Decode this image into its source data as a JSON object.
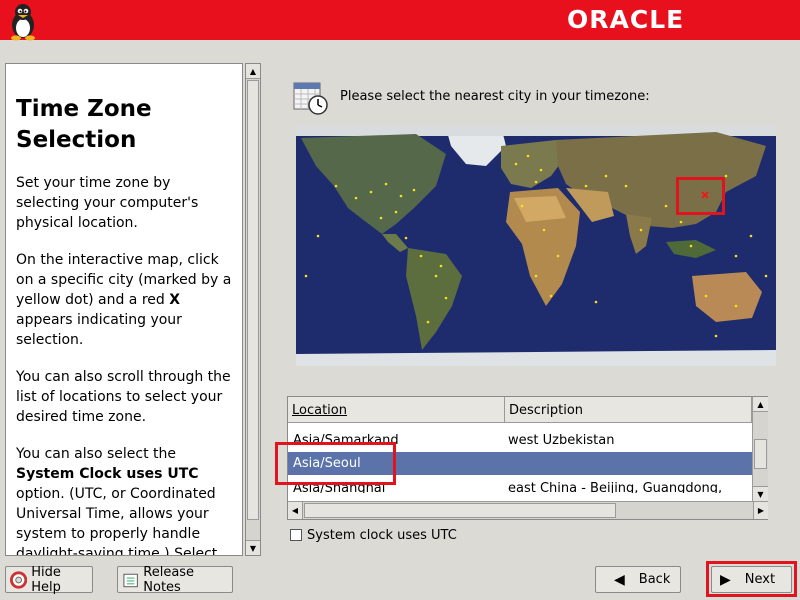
{
  "header": {
    "brand": "ORACLE"
  },
  "help": {
    "title": "Time Zone Selection",
    "p1": "Set your time zone by selecting your computer's physical location.",
    "p2a": "On the interactive map, click on a specific city (marked by a yellow dot) and a red ",
    "p2b": "X",
    "p2c": " appears indicating your selection.",
    "p3": "You can also scroll through the list of locations to select your desired time zone.",
    "p4a": "You can also select the ",
    "p4b": "System Clock uses UTC",
    "p4c": " option. (UTC, or Coordinated Universal Time, allows your system to properly handle daylight-saving time.) Select"
  },
  "main": {
    "instruction": "Please select the nearest city in your timezone:",
    "columns": [
      "Location",
      "Description"
    ],
    "rows": [
      {
        "location": "Asia/Samarkand",
        "description": "west Uzbekistan"
      },
      {
        "location": "Asia/Seoul",
        "description": ""
      },
      {
        "location": "Asia/Shanghai",
        "description": "east China - Beijing, Guangdong, Shanghai, etc"
      }
    ],
    "selected_location": "Asia/Seoul",
    "utc_label": "System clock uses UTC",
    "utc_checked": false
  },
  "buttons": {
    "hide_help": "Hide Help",
    "release_notes": "Release Notes",
    "back": "Back",
    "next": "Next"
  },
  "colors": {
    "header_red": "#e8101c",
    "selection_blue": "#5b73a8",
    "highlight_red": "#e0141e"
  }
}
